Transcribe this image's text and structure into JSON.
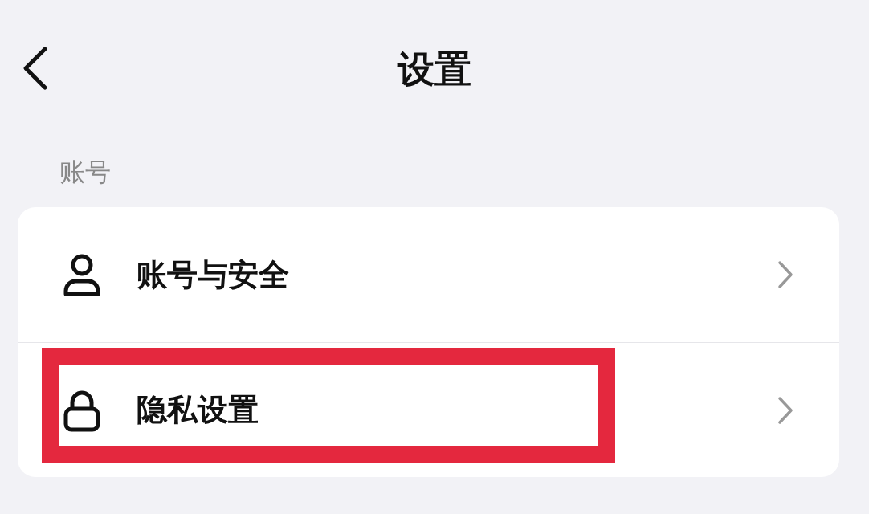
{
  "header": {
    "title": "设置"
  },
  "section": {
    "label": "账号"
  },
  "items": [
    {
      "label": "账号与安全",
      "kind": "person",
      "highlighted": false
    },
    {
      "label": "隐私设置",
      "kind": "lock",
      "highlighted": true
    }
  ]
}
